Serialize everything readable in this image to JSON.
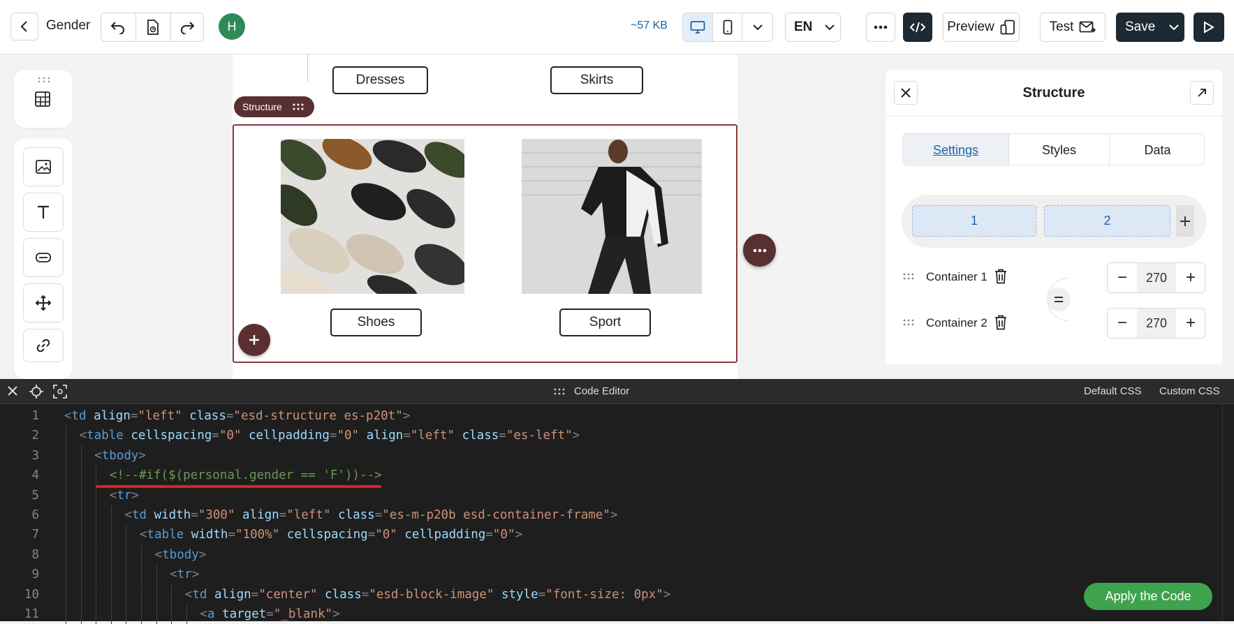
{
  "topbar": {
    "title": "Gender",
    "avatar_letter": "H",
    "size": "~57 KB",
    "language": "EN",
    "preview_label": "Preview",
    "test_label": "Test",
    "save_label": "Save"
  },
  "canvas": {
    "top_buttons": [
      "Dresses",
      "Skirts"
    ],
    "structure_tag": "Structure",
    "product_buttons": [
      "Shoes",
      "Sport"
    ]
  },
  "panel": {
    "title": "Structure",
    "tabs": [
      "Settings",
      "Styles",
      "Data"
    ],
    "active_tab": "Settings",
    "columns": [
      "1",
      "2"
    ],
    "containers": [
      {
        "label": "Container 1",
        "width": "270"
      },
      {
        "label": "Container 2",
        "width": "270"
      }
    ]
  },
  "editor": {
    "title": "Code Editor",
    "default_css": "Default CSS",
    "custom_css": "Custom CSS",
    "apply_label": "Apply the Code",
    "lines": [
      {
        "n": "1",
        "indent": 0,
        "tokens": [
          [
            "p",
            "<"
          ],
          [
            "t",
            "td"
          ],
          [
            "x",
            " "
          ],
          [
            "a",
            "align"
          ],
          [
            "p",
            "="
          ],
          [
            "v",
            "\"left\""
          ],
          [
            "x",
            " "
          ],
          [
            "a",
            "class"
          ],
          [
            "p",
            "="
          ],
          [
            "v",
            "\"esd-structure es-p20t\""
          ],
          [
            "p",
            ">"
          ]
        ]
      },
      {
        "n": "2",
        "indent": 1,
        "tokens": [
          [
            "p",
            "<"
          ],
          [
            "t",
            "table"
          ],
          [
            "x",
            " "
          ],
          [
            "a",
            "cellspacing"
          ],
          [
            "p",
            "="
          ],
          [
            "v",
            "\"0\""
          ],
          [
            "x",
            " "
          ],
          [
            "a",
            "cellpadding"
          ],
          [
            "p",
            "="
          ],
          [
            "v",
            "\"0\""
          ],
          [
            "x",
            " "
          ],
          [
            "a",
            "align"
          ],
          [
            "p",
            "="
          ],
          [
            "v",
            "\"left\""
          ],
          [
            "x",
            " "
          ],
          [
            "a",
            "class"
          ],
          [
            "p",
            "="
          ],
          [
            "v",
            "\"es-left\""
          ],
          [
            "p",
            ">"
          ]
        ]
      },
      {
        "n": "3",
        "indent": 2,
        "tokens": [
          [
            "p",
            "<"
          ],
          [
            "t",
            "tbody"
          ],
          [
            "p",
            ">"
          ]
        ]
      },
      {
        "n": "4",
        "indent": 3,
        "tokens": [
          [
            "c",
            "<!--#if($(personal.gender == 'F'))-->"
          ]
        ]
      },
      {
        "n": "5",
        "indent": 3,
        "tokens": [
          [
            "p",
            "<"
          ],
          [
            "t",
            "tr"
          ],
          [
            "p",
            ">"
          ]
        ]
      },
      {
        "n": "6",
        "indent": 4,
        "tokens": [
          [
            "p",
            "<"
          ],
          [
            "t",
            "td"
          ],
          [
            "x",
            " "
          ],
          [
            "a",
            "width"
          ],
          [
            "p",
            "="
          ],
          [
            "v",
            "\"300\""
          ],
          [
            "x",
            " "
          ],
          [
            "a",
            "align"
          ],
          [
            "p",
            "="
          ],
          [
            "v",
            "\"left\""
          ],
          [
            "x",
            " "
          ],
          [
            "a",
            "class"
          ],
          [
            "p",
            "="
          ],
          [
            "v",
            "\"es-m-p20b esd-container-frame\""
          ],
          [
            "p",
            ">"
          ]
        ]
      },
      {
        "n": "7",
        "indent": 5,
        "tokens": [
          [
            "p",
            "<"
          ],
          [
            "t",
            "table"
          ],
          [
            "x",
            " "
          ],
          [
            "a",
            "width"
          ],
          [
            "p",
            "="
          ],
          [
            "v",
            "\"100%\""
          ],
          [
            "x",
            " "
          ],
          [
            "a",
            "cellspacing"
          ],
          [
            "p",
            "="
          ],
          [
            "v",
            "\"0\""
          ],
          [
            "x",
            " "
          ],
          [
            "a",
            "cellpadding"
          ],
          [
            "p",
            "="
          ],
          [
            "v",
            "\"0\""
          ],
          [
            "p",
            ">"
          ]
        ]
      },
      {
        "n": "8",
        "indent": 6,
        "tokens": [
          [
            "p",
            "<"
          ],
          [
            "t",
            "tbody"
          ],
          [
            "p",
            ">"
          ]
        ]
      },
      {
        "n": "9",
        "indent": 7,
        "tokens": [
          [
            "p",
            "<"
          ],
          [
            "t",
            "tr"
          ],
          [
            "p",
            ">"
          ]
        ]
      },
      {
        "n": "10",
        "indent": 8,
        "tokens": [
          [
            "p",
            "<"
          ],
          [
            "t",
            "td"
          ],
          [
            "x",
            " "
          ],
          [
            "a",
            "align"
          ],
          [
            "p",
            "="
          ],
          [
            "v",
            "\"center\""
          ],
          [
            "x",
            " "
          ],
          [
            "a",
            "class"
          ],
          [
            "p",
            "="
          ],
          [
            "v",
            "\"esd-block-image\""
          ],
          [
            "x",
            " "
          ],
          [
            "a",
            "style"
          ],
          [
            "p",
            "="
          ],
          [
            "v",
            "\"font-size: 0px\""
          ],
          [
            "p",
            ">"
          ]
        ]
      },
      {
        "n": "11",
        "indent": 9,
        "tokens": [
          [
            "p",
            "<"
          ],
          [
            "t",
            "a"
          ],
          [
            "x",
            " "
          ],
          [
            "a",
            "target"
          ],
          [
            "p",
            "="
          ],
          [
            "v",
            "\"_blank\""
          ],
          [
            "p",
            ">"
          ]
        ]
      }
    ]
  },
  "colors": {
    "accent_dark": "#1e2a33",
    "brand_maroon": "#5a2f30",
    "avatar_green": "#2e8b57",
    "apply_green": "#3fa34d",
    "highlight_underline": "#e02020"
  }
}
